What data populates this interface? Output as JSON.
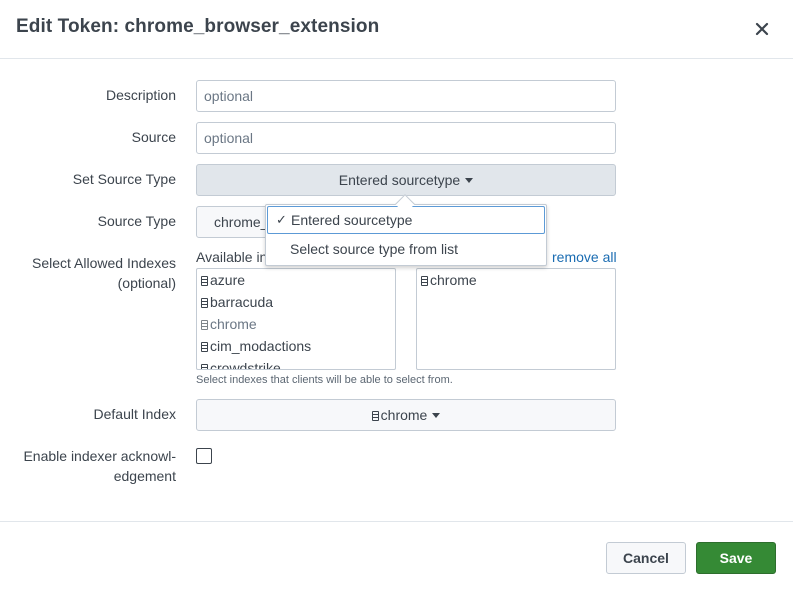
{
  "header": {
    "title": "Edit Token: chrome_browser_extension",
    "close_icon": "close-icon"
  },
  "form": {
    "description": {
      "label": "Description",
      "placeholder": "optional",
      "value": ""
    },
    "source": {
      "label": "Source",
      "placeholder": "optional",
      "value": ""
    },
    "set_source_type": {
      "label": "Set Source Type",
      "value": "Entered sourcetype"
    },
    "source_type": {
      "label": "Source Type",
      "value": "chrome_"
    },
    "source_type_menu": {
      "items": [
        {
          "label": "Entered sourcetype",
          "selected": true
        },
        {
          "label": "Select source type from list",
          "selected": false
        }
      ]
    },
    "allowed_indexes": {
      "label_line1": "Select Allowed Indexes",
      "label_line2": "(optional)",
      "available_label": "Available in",
      "remove_all": "remove all",
      "available": [
        {
          "name": "azure",
          "disabled": false
        },
        {
          "name": "barracuda",
          "disabled": false
        },
        {
          "name": "chrome",
          "disabled": true
        },
        {
          "name": "cim_modactions",
          "disabled": false
        },
        {
          "name": "crowdstrike",
          "disabled": false
        }
      ],
      "selected": [
        {
          "name": "chrome"
        }
      ],
      "help": "Select indexes that clients will be able to select from."
    },
    "default_index": {
      "label": "Default Index",
      "value": "chrome"
    },
    "indexer_ack": {
      "label_line1": "Enable indexer acknowl-",
      "label_line2": "edgement",
      "checked": false
    }
  },
  "footer": {
    "cancel": "Cancel",
    "save": "Save"
  },
  "colors": {
    "save_green": "#358a35",
    "link_blue": "#1a6cb2",
    "select_bg": "#e1e6eb",
    "dropdown_focus": "#5c9ad6"
  }
}
